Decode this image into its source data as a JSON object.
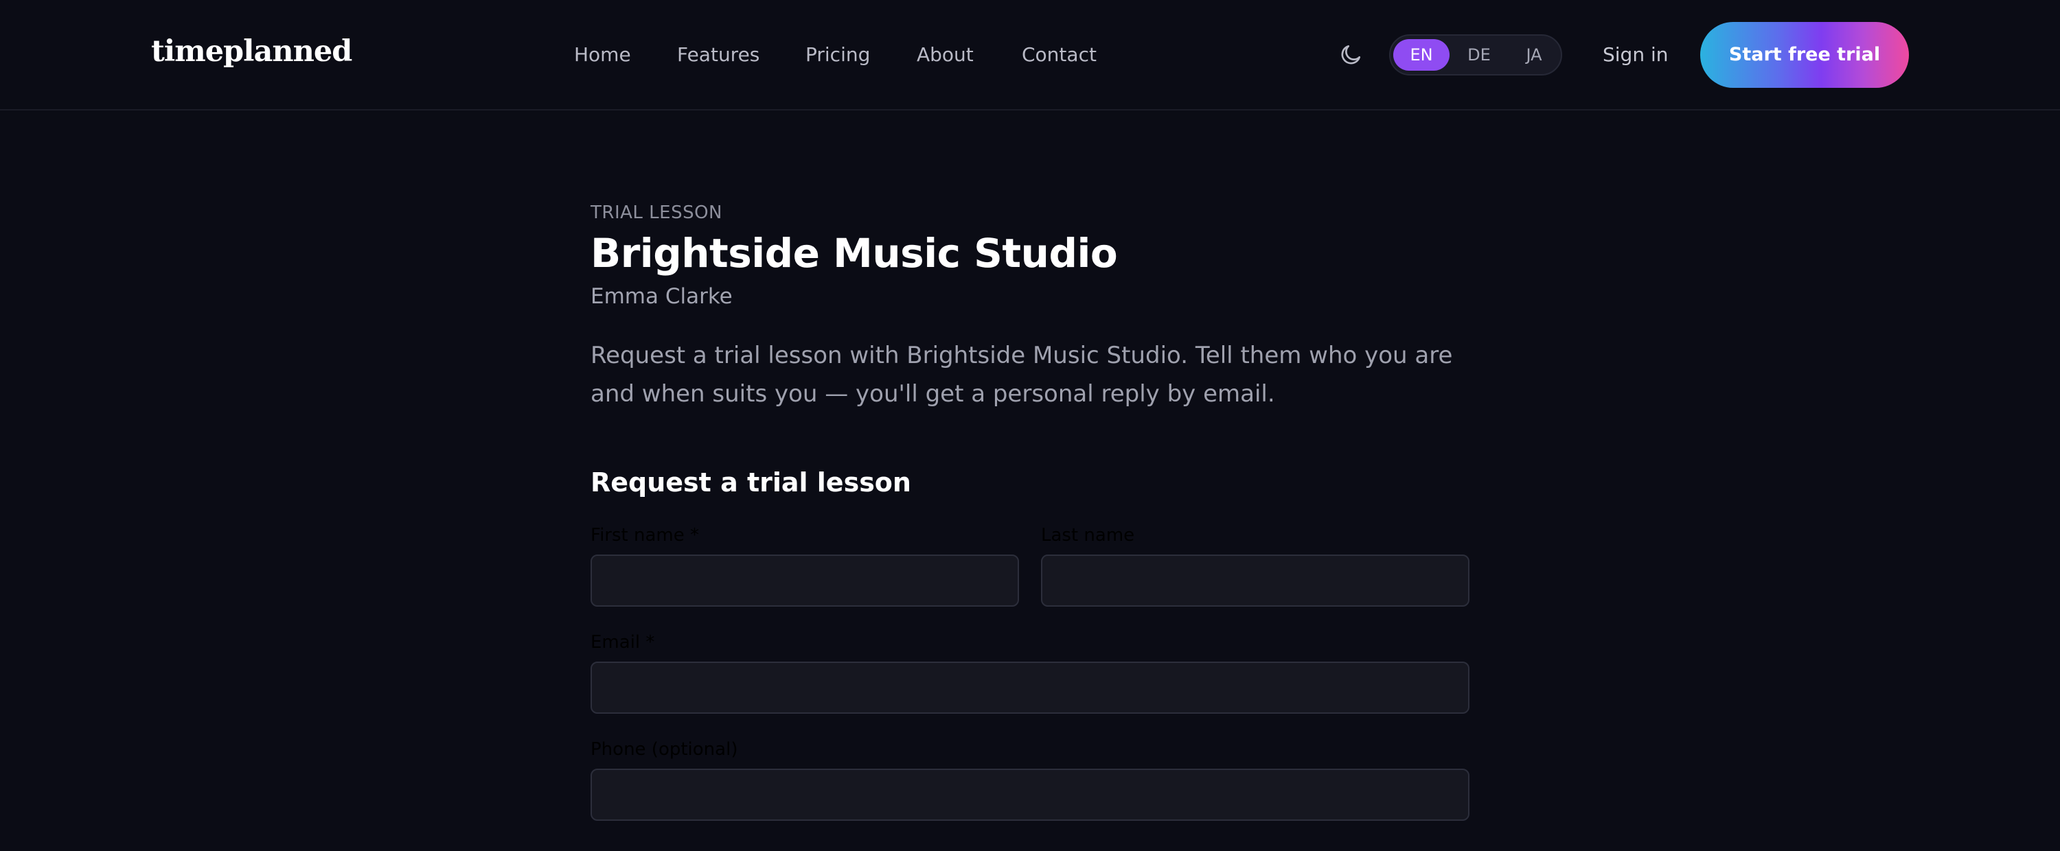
{
  "header": {
    "logo": "timeplanned",
    "nav": [
      "Home",
      "Features",
      "Pricing",
      "About",
      "Contact"
    ],
    "theme_toggle_icon": "moon-icon",
    "languages": [
      "EN",
      "DE",
      "JA"
    ],
    "active_language": "EN",
    "sign_in": "Sign in",
    "cta": "Start free trial"
  },
  "page": {
    "eyebrow": "TRIAL LESSON",
    "title": "Brightside Music Studio",
    "teacher": "Emma Clarke",
    "intro": "Request a trial lesson with Brightside Music Studio. Tell them who you are and when suits you — you'll get a personal reply by email."
  },
  "form": {
    "title": "Request a trial lesson",
    "first_name_label": "First name *",
    "first_name_value": "",
    "last_name_label": "Last name",
    "last_name_value": "",
    "email_label": "Email *",
    "email_value": "",
    "phone_label": "Phone (optional)",
    "phone_value": ""
  },
  "colors": {
    "background": "#0b0c15",
    "accent": "#8f4cf2",
    "cta_gradient_start": "#2bb2e0",
    "cta_gradient_mid": "#7f3df0",
    "cta_gradient_end": "#ee4aa0",
    "input_background": "#161720"
  }
}
